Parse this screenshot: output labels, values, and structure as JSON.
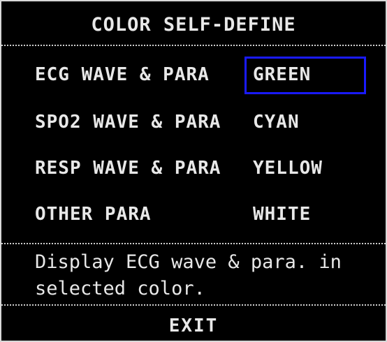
{
  "dialog": {
    "title": "COLOR SELF-DEFINE",
    "selected_row": 0,
    "rows": [
      {
        "label": "ECG WAVE & PARA",
        "value": "GREEN"
      },
      {
        "label": "SPO2 WAVE & PARA",
        "value": "CYAN"
      },
      {
        "label": "RESP WAVE & PARA",
        "value": "YELLOW"
      },
      {
        "label": "OTHER PARA",
        "value": "WHITE"
      }
    ],
    "help_text": "Display ECG wave & para. in\nselected color.",
    "exit_label": "EXIT"
  },
  "colors": {
    "background": "#000000",
    "text": "#e8e8e8",
    "selection_border": "#1a1aff"
  }
}
